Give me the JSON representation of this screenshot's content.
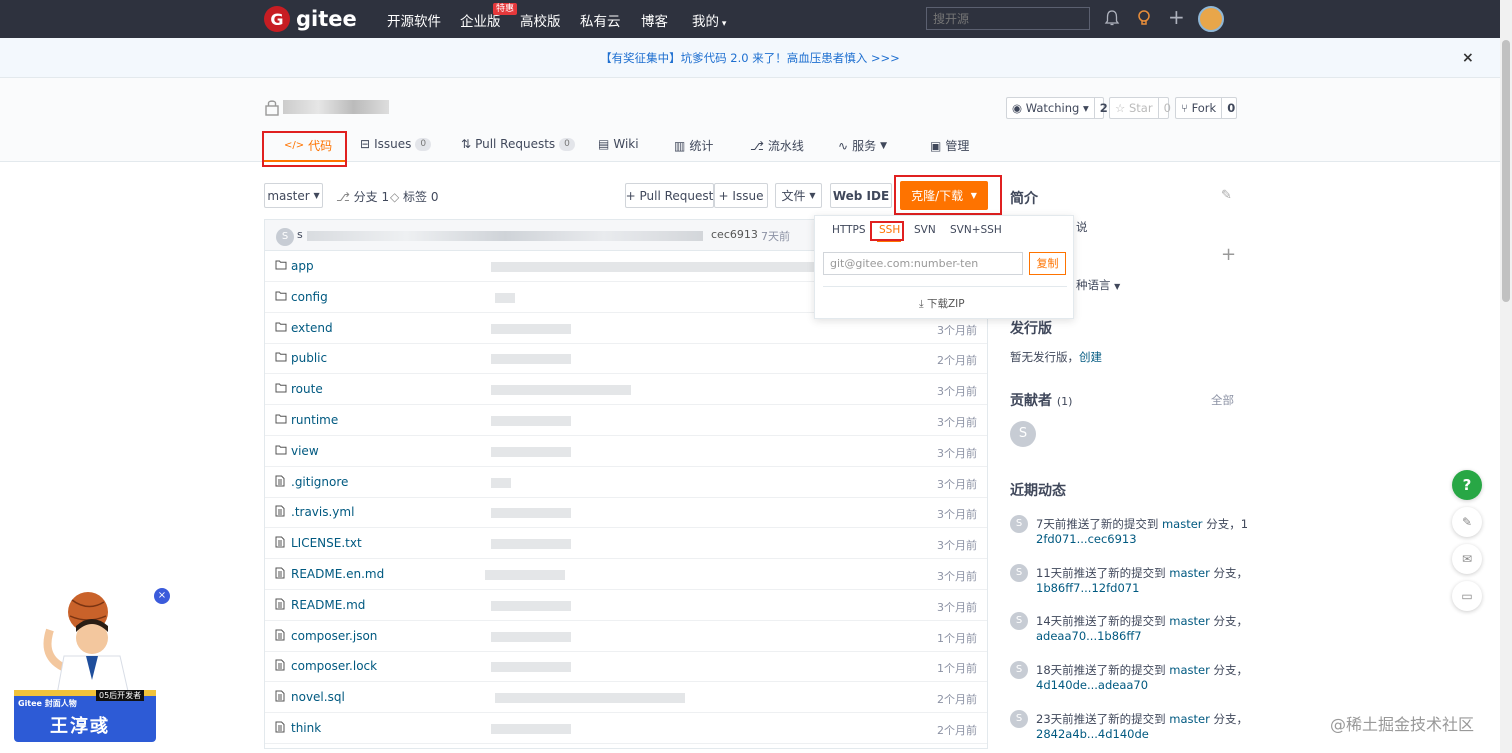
{
  "topnav": {
    "logo_letter": "G",
    "logo_text": "gitee",
    "items": [
      "开源软件",
      "企业版",
      "高校版",
      "私有云",
      "博客",
      "我的"
    ],
    "hot_badge": "特惠",
    "search_placeholder": "搜开源"
  },
  "banner": {
    "text": "【有奖征集中】坑爹代码 2.0 来了！高血压患者慎入 >>>",
    "close": "×"
  },
  "repo": {
    "watching_label": "Watching",
    "watching_count": "2",
    "star_label": "Star",
    "star_count": "0",
    "fork_label": "Fork",
    "fork_count": "0"
  },
  "tabs": [
    {
      "label": "代码"
    },
    {
      "label": "Issues",
      "badge": "0"
    },
    {
      "label": "Pull Requests",
      "badge": "0"
    },
    {
      "label": "Wiki"
    },
    {
      "label": "统计"
    },
    {
      "label": "流水线"
    },
    {
      "label": "服务"
    },
    {
      "label": "管理"
    }
  ],
  "toolbar": {
    "branch": "master",
    "branches": "分支 1",
    "tags": "标签 0",
    "pull_request": "+ Pull Request",
    "issue": "+ Issue",
    "file": "文件",
    "web_ide": "Web IDE",
    "clone": "克隆/下载"
  },
  "commit": {
    "avatar": "S",
    "prefix": "s",
    "hash": "cec6913",
    "time": "7天前"
  },
  "files": [
    {
      "name": "app",
      "type": "folder",
      "time": ""
    },
    {
      "name": "config",
      "type": "folder",
      "time": ""
    },
    {
      "name": "extend",
      "type": "folder",
      "time": "3个月前"
    },
    {
      "name": "public",
      "type": "folder",
      "time": "2个月前"
    },
    {
      "name": "route",
      "type": "folder",
      "time": "3个月前"
    },
    {
      "name": "runtime",
      "type": "folder",
      "time": "3个月前"
    },
    {
      "name": "view",
      "type": "folder",
      "time": "3个月前"
    },
    {
      "name": ".gitignore",
      "type": "file",
      "time": "3个月前"
    },
    {
      "name": ".travis.yml",
      "type": "file",
      "time": "3个月前"
    },
    {
      "name": "LICENSE.txt",
      "type": "file",
      "time": "3个月前"
    },
    {
      "name": "README.en.md",
      "type": "file",
      "time": "3个月前"
    },
    {
      "name": "README.md",
      "type": "file",
      "time": "3个月前"
    },
    {
      "name": "composer.json",
      "type": "file",
      "time": "1个月前"
    },
    {
      "name": "composer.lock",
      "type": "file",
      "time": "1个月前"
    },
    {
      "name": "novel.sql",
      "type": "file",
      "time": "2个月前"
    },
    {
      "name": "think",
      "type": "file",
      "time": "2个月前"
    }
  ],
  "clone_dropdown": {
    "tabs": [
      "HTTPS",
      "SSH",
      "SVN",
      "SVN+SSH"
    ],
    "url": "git@gitee.com:number-ten",
    "copy": "复制",
    "download": "下载ZIP"
  },
  "sidebar": {
    "intro_title": "简介",
    "intro_text": "说",
    "lang_text": "种语言",
    "release_title": "发行版",
    "release_text": "暂无发行版，",
    "release_link": "创建",
    "contrib_title": "贡献者",
    "contrib_count": "(1)",
    "contrib_all": "全部",
    "contrib_avatar": "S",
    "activity_title": "近期动态",
    "activities": [
      {
        "text": "7天前推送了新的提交到",
        "branch": "master",
        "suffix": "分支，1",
        "range": "2fd071...cec6913"
      },
      {
        "text": "11天前推送了新的提交到",
        "branch": "master",
        "suffix": "分支，",
        "range": "1b86ff7...12fd071"
      },
      {
        "text": "14天前推送了新的提交到",
        "branch": "master",
        "suffix": "分支，",
        "range": "adeaa70...1b86ff7"
      },
      {
        "text": "18天前推送了新的提交到",
        "branch": "master",
        "suffix": "分支，",
        "range": "4d140de...adeaa70"
      },
      {
        "text": "23天前推送了新的提交到",
        "branch": "master",
        "suffix": "分支，",
        "range": "2842a4b...4d140de"
      }
    ]
  },
  "promo": {
    "tag": "Gitee",
    "tag2": "封面人物",
    "age": "05后开发者",
    "name": "王淳彧"
  },
  "watermark": "@稀土掘金技术社区",
  "float": {
    "help": "?"
  }
}
